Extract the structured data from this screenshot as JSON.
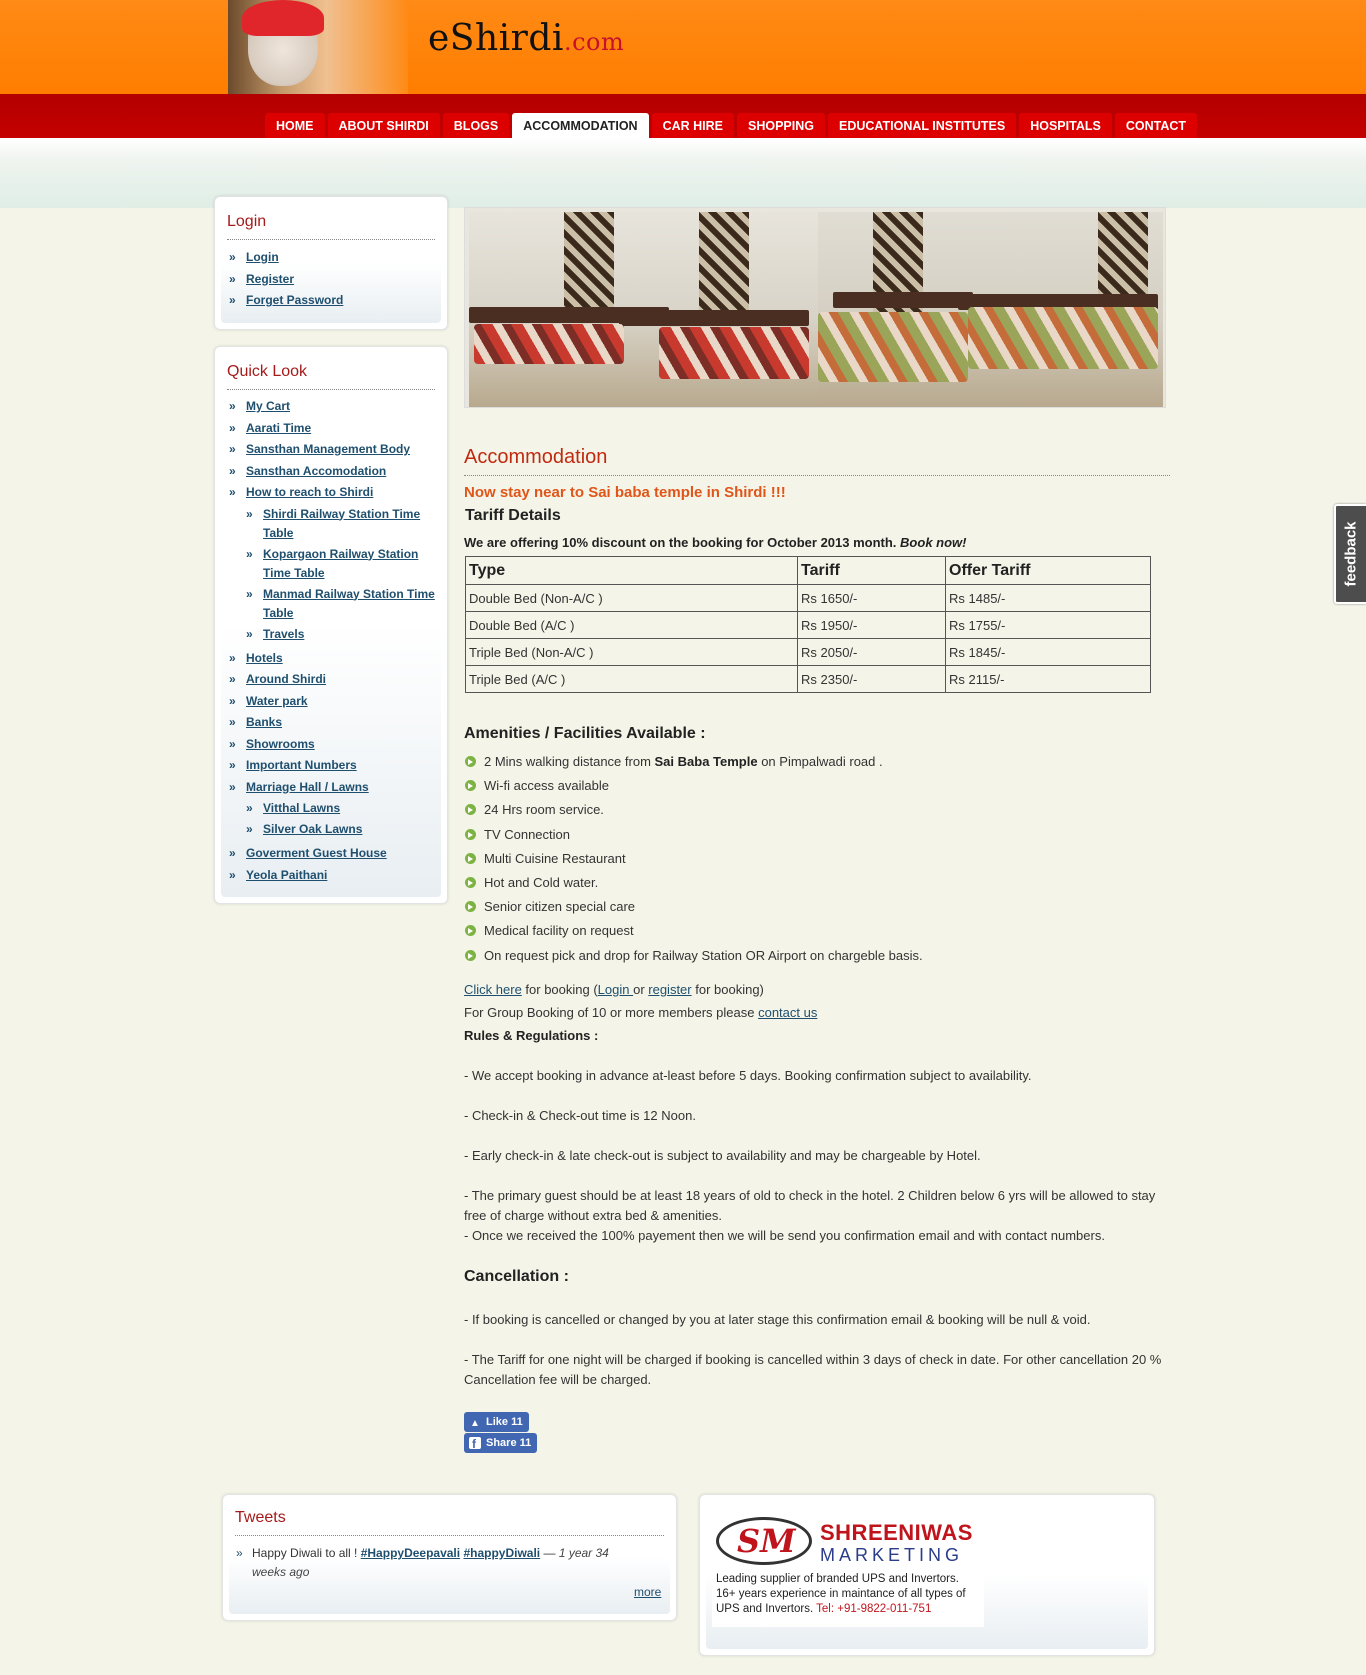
{
  "site": {
    "name": "eShirdi",
    "domain_suffix": ".com"
  },
  "nav": [
    {
      "label": "HOME",
      "active": false
    },
    {
      "label": "ABOUT SHIRDI",
      "active": false
    },
    {
      "label": "BLOGS",
      "active": false
    },
    {
      "label": "ACCOMMODATION",
      "active": true
    },
    {
      "label": "CAR HIRE",
      "active": false
    },
    {
      "label": "SHOPPING",
      "active": false
    },
    {
      "label": "EDUCATIONAL INSTITUTES",
      "active": false
    },
    {
      "label": "HOSPITALS",
      "active": false
    },
    {
      "label": "CONTACT",
      "active": false
    }
  ],
  "login_box": {
    "title": "Login",
    "items": [
      "Login",
      "Register",
      "Forget Password"
    ]
  },
  "quicklook": {
    "title": "Quick Look",
    "items": [
      {
        "label": "My Cart"
      },
      {
        "label": "Aarati Time"
      },
      {
        "label": "Sansthan Management Body"
      },
      {
        "label": "Sansthan Accomodation"
      },
      {
        "label": "How to reach to Shirdi"
      },
      {
        "label": "Shirdi Railway Station Time",
        "label2": "Table",
        "sub": true
      },
      {
        "label": "Kopargaon Railway Station",
        "label2": "Time Table",
        "sub": true
      },
      {
        "label": "Manmad Railway Station Time",
        "label2": "Table",
        "sub": true
      },
      {
        "label": "Travels",
        "sub": true
      },
      {
        "label": "Hotels"
      },
      {
        "label": "Around Shirdi"
      },
      {
        "label": "Water park"
      },
      {
        "label": "Banks"
      },
      {
        "label": "Showrooms"
      },
      {
        "label": "Important Numbers"
      },
      {
        "label": "Marriage Hall / Lawns"
      },
      {
        "label": "Vitthal Lawns",
        "sub": true
      },
      {
        "label": "Silver Oak Lawns",
        "sub": true
      },
      {
        "label": "Goverment Guest House"
      },
      {
        "label": "Yeola Paithani"
      }
    ]
  },
  "main": {
    "title": "Accommodation",
    "tagline": "Now stay near to Sai baba temple in Shirdi !!!",
    "tariff_heading": "Tariff Details",
    "offer_text": "We are offering 10% discount on the booking for October 2013 month.",
    "offer_cta": "Book now!",
    "table": {
      "headers": [
        "Type",
        "Tariff",
        "Offer Tariff"
      ],
      "rows": [
        [
          "Double Bed (Non-A/C )",
          "Rs 1650/-",
          "Rs 1485/-"
        ],
        [
          "Double Bed (A/C )",
          "Rs 1950/-",
          "Rs 1755/-"
        ],
        [
          "Triple Bed (Non-A/C )",
          "Rs 2050/-",
          "Rs 1845/-"
        ],
        [
          "Triple Bed (A/C )",
          "Rs 2350/-",
          "Rs 2115/-"
        ]
      ]
    },
    "amenities_heading": "Amenities / Facilities Available :",
    "amenities": [
      {
        "pre": "2 Mins walking distance from ",
        "bold": "Sai Baba Temple",
        "post": " on Pimpalwadi road ."
      },
      {
        "pre": "Wi-fi access available"
      },
      {
        "pre": "24 Hrs room service."
      },
      {
        "pre": "TV Connection"
      },
      {
        "pre": "Multi Cuisine Restaurant"
      },
      {
        "pre": "Hot and Cold water."
      },
      {
        "pre": "Senior citizen special care"
      },
      {
        "pre": "Medical facility on request"
      },
      {
        "pre": "On request pick and drop for Railway Station OR Airport on chargeble basis."
      }
    ],
    "booking": {
      "click_here": "Click here",
      "for_booking": " for booking (",
      "login": "Login ",
      "or": "or ",
      "register": "register",
      "for_booking_end": " for booking)",
      "group_text": "For Group Booking of 10 or more members please ",
      "contact_us": "contact us"
    },
    "rules_heading": "Rules & Regulations :",
    "rules": [
      "- We accept booking in advance at-least before 5 days. Booking confirmation subject to availability.",
      "- Check-in & Check-out time is 12 Noon.",
      "- Early check-in & late check-out is subject to availability and may be chargeable by Hotel.",
      "- The primary guest should be at least 18 years of old to check in  the hotel. 2 Children below 6 yrs will be allowed to stay free of charge without extra bed & amenities.",
      "- Once we received the 100% payement then we will be send you confirmation email and with contact numbers."
    ],
    "cancellation_heading": "Cancellation :",
    "cancellation": [
      "- If booking is cancelled or changed by you at later stage this confirmation email & booking will be null & void.",
      "- The Tariff for one night will be charged if booking is cancelled within 3 days of check in date.  For other cancellation 20 % Cancellation fee will be charged."
    ],
    "like_label": "Like 11",
    "share_label": "Share 11"
  },
  "feedback_label": "feedback",
  "tweets": {
    "title": "Tweets",
    "text": "Happy Diwali to all ! ",
    "tag1": "#HappyDeepavali",
    "tag2": "#happyDiwali",
    "dash": " — ",
    "time": "1 year 34 weeks ago",
    "more": "more"
  },
  "ad": {
    "logo_letters": "SM",
    "name": "SHREENIWAS",
    "sub": "MARKETING",
    "line1": "Leading supplier of branded UPS and Invertors.",
    "line2": "16+ years experience in maintance of all types of",
    "line3": "UPS and Invertors. ",
    "tel": "Tel: +91-9822-011-751"
  }
}
